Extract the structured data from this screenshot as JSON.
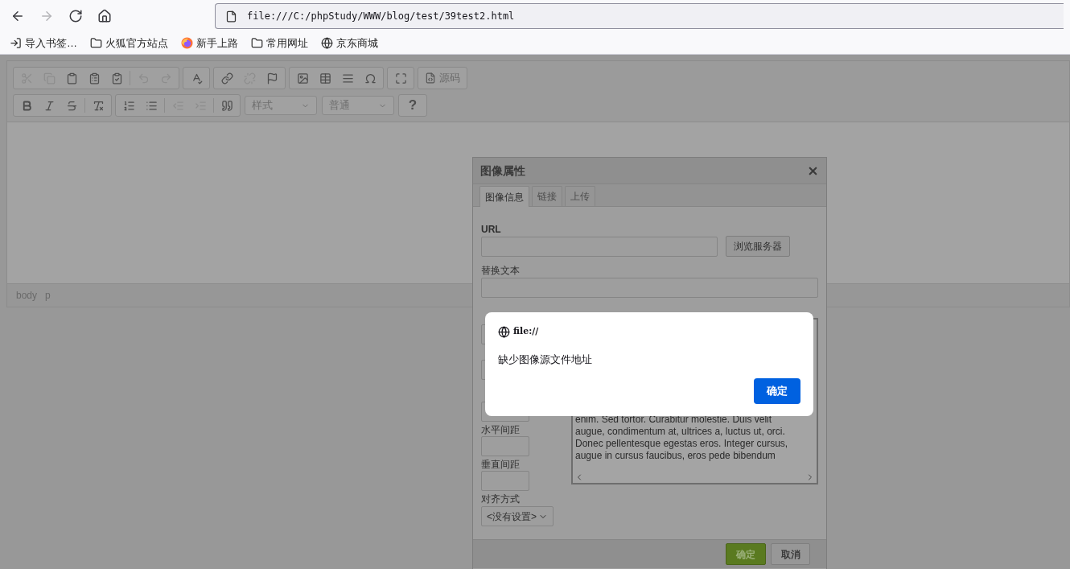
{
  "browser": {
    "nav": [
      {
        "kind": "back",
        "disabled": false
      },
      {
        "kind": "forward",
        "disabled": true
      },
      {
        "kind": "reload",
        "disabled": false
      },
      {
        "kind": "home",
        "disabled": false
      }
    ],
    "url": "file:///C:/phpStudy/WWW/blog/test/39test2.html",
    "bookmarks": [
      {
        "kind": "import",
        "label": "导入书签…"
      },
      {
        "kind": "folder",
        "label": "火狐官方站点"
      },
      {
        "kind": "firefox",
        "label": "新手上路"
      },
      {
        "kind": "folder",
        "label": "常用网址"
      },
      {
        "kind": "globe",
        "label": "京东商城"
      }
    ]
  },
  "editor": {
    "toolbar_rows": [
      [
        {
          "buttons": [
            {
              "kind": "cut",
              "disabled": true
            },
            {
              "kind": "copy",
              "disabled": true
            },
            {
              "kind": "paste",
              "disabled": false
            },
            {
              "kind": "paste-text",
              "disabled": false
            },
            {
              "kind": "paste-word",
              "disabled": false
            },
            {
              "kind": "separator"
            },
            {
              "kind": "undo",
              "disabled": true
            },
            {
              "kind": "redo",
              "disabled": true
            }
          ]
        },
        {
          "buttons": [
            {
              "kind": "spellcheck",
              "disabled": false
            }
          ]
        },
        {
          "buttons": [
            {
              "kind": "link",
              "disabled": false
            },
            {
              "kind": "unlink",
              "disabled": true
            },
            {
              "kind": "anchor",
              "disabled": false
            }
          ]
        },
        {
          "buttons": [
            {
              "kind": "image",
              "disabled": false
            },
            {
              "kind": "table",
              "disabled": false
            },
            {
              "kind": "rule",
              "disabled": false
            },
            {
              "kind": "omega",
              "disabled": false
            }
          ]
        },
        {
          "buttons": [
            {
              "kind": "maximize",
              "disabled": false
            }
          ]
        },
        {
          "buttons": [
            {
              "kind": "source",
              "label": "源码",
              "disabled": false
            }
          ]
        }
      ],
      [
        {
          "buttons": [
            {
              "kind": "bold",
              "disabled": false
            },
            {
              "kind": "italic",
              "disabled": false
            },
            {
              "kind": "strike",
              "disabled": false
            },
            {
              "kind": "separator"
            },
            {
              "kind": "clear-format",
              "disabled": false
            }
          ]
        },
        {
          "buttons": [
            {
              "kind": "numbered-list",
              "disabled": false
            },
            {
              "kind": "bulleted-list",
              "disabled": false
            },
            {
              "kind": "separator"
            },
            {
              "kind": "outdent",
              "disabled": true
            },
            {
              "kind": "indent",
              "disabled": true
            },
            {
              "kind": "separator"
            },
            {
              "kind": "quote",
              "disabled": false
            }
          ]
        },
        {
          "buttons": [
            {
              "kind": "combo",
              "label": "样式"
            }
          ]
        },
        {
          "buttons": [
            {
              "kind": "combo",
              "label": "普通"
            }
          ]
        },
        {
          "buttons": [
            {
              "kind": "help",
              "label": "?",
              "disabled": false
            }
          ]
        }
      ]
    ],
    "elements_path": [
      "body",
      "p"
    ]
  },
  "dialog": {
    "title": "图像属性",
    "tabs": [
      {
        "label": "图像信息",
        "selected": true
      },
      {
        "label": "链接",
        "selected": false
      },
      {
        "label": "上传",
        "selected": false
      }
    ],
    "url_label": "URL",
    "browse_button": "浏览服务器",
    "alt_label": "替换文本",
    "spacing_fields": [
      {
        "label": "水平间距"
      },
      {
        "label": "垂直间距"
      }
    ],
    "align_label": "对齐方式",
    "align_value": "<没有设置>",
    "preview_lines": [
      "enim. Sed tortor. Curabitur molestie. Duis velit",
      "augue, condimentum at, ultrices a, luctus ut, orci.",
      "Donec pellentesque egestas eros. Integer cursus,",
      "augue in cursus faucibus, eros pede bibendum"
    ],
    "ok_button": "确定",
    "cancel_button": "取消"
  },
  "alert": {
    "origin": "file://",
    "message": "缺少图像源文件地址",
    "ok_button": "确定"
  }
}
